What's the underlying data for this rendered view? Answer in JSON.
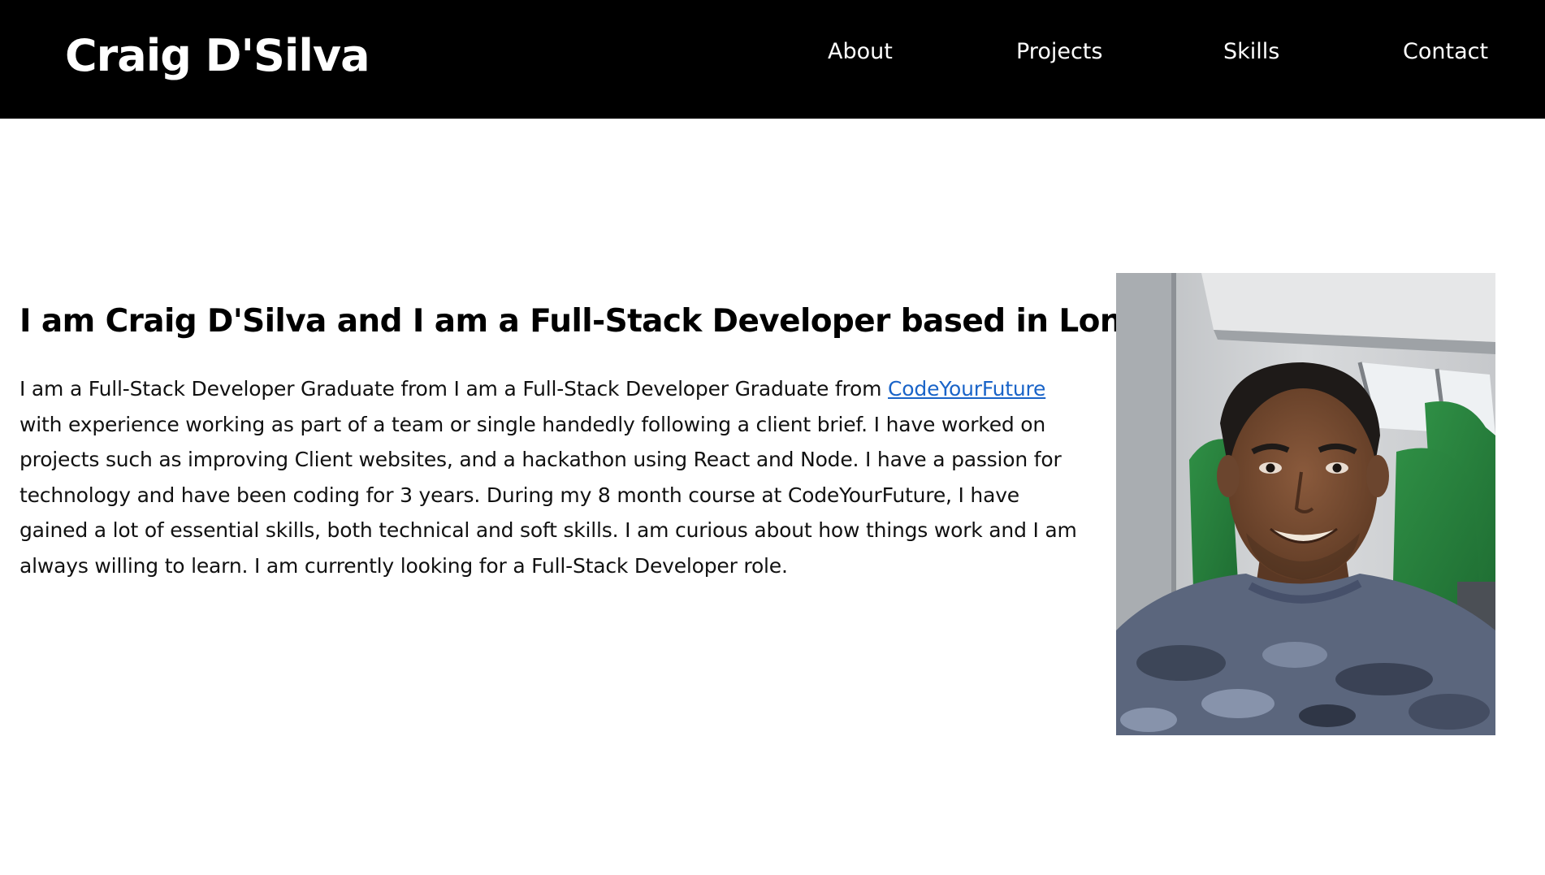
{
  "header": {
    "site_title": "Craig D'Silva",
    "nav": {
      "about": "About",
      "projects": "Projects",
      "skills": "Skills",
      "contact": "Contact"
    }
  },
  "about": {
    "heading": "I am Craig D'Silva and I am a Full-Stack Developer based in London",
    "text_before_link": "I am a Full-Stack Developer Graduate from I am a Full-Stack Developer Graduate from ",
    "link_text": "CodeYourFuture",
    "text_after_link": " with experience working as part of a team or single handedly following a client brief. I have worked on projects such as improving Client websites, and a hackathon using React and Node. I have a passion for technology and have been coding for 3 years. During my 8 month course at CodeYourFuture, I have gained a lot of essential skills, both technical and soft skills. I am curious about how things work and I am always willing to learn. I am currently looking for a Full-Stack Developer role."
  },
  "photo": {
    "subject": "portrait-photo"
  },
  "colors": {
    "navbar_bg": "#000000",
    "nav_text": "#ffffff",
    "body_text": "#111111",
    "link": "#1a64c8",
    "background": "#ffffff"
  }
}
